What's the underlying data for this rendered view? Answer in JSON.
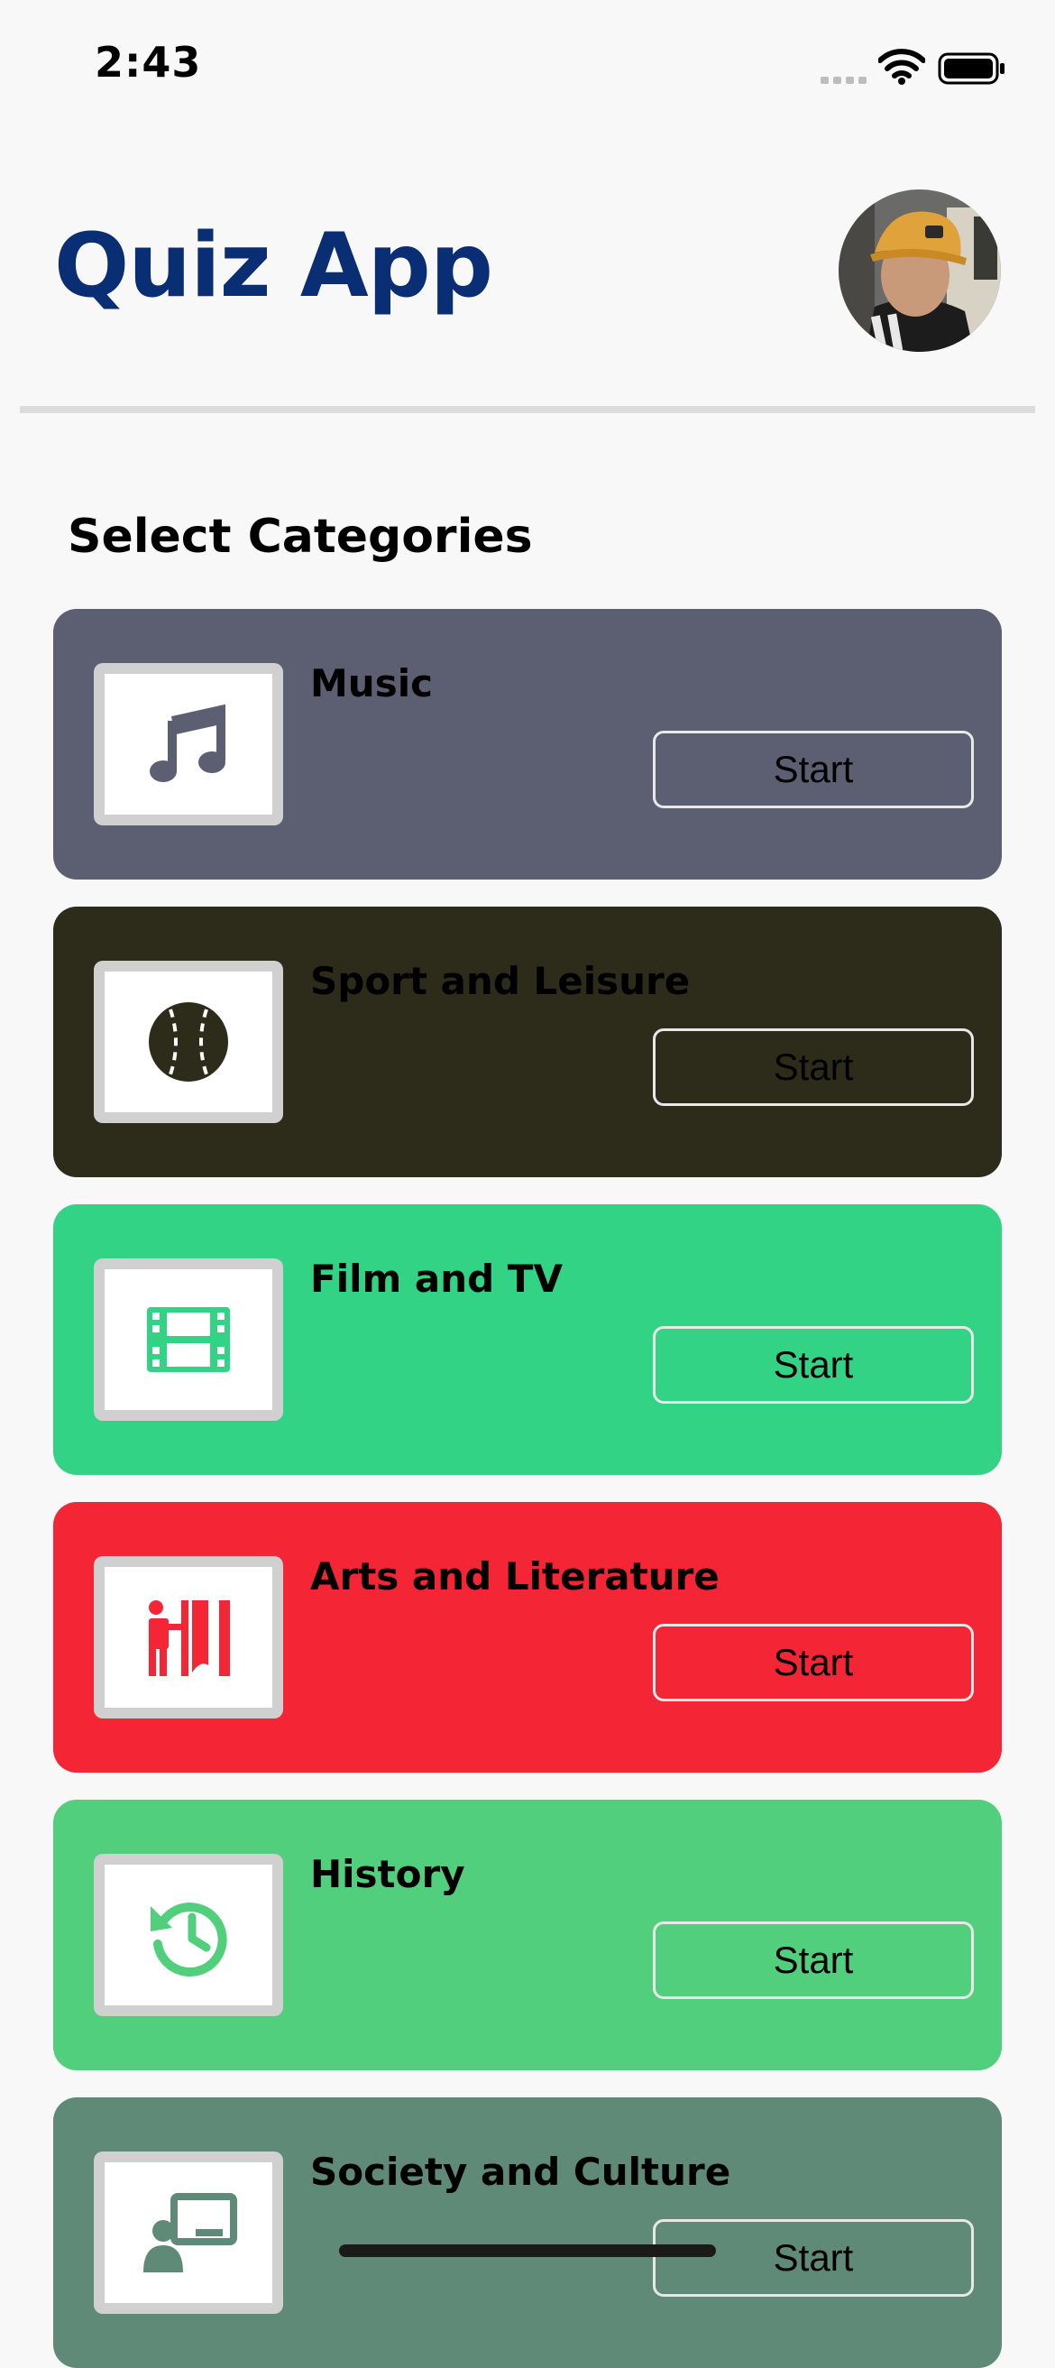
{
  "status_bar": {
    "time": "2:43"
  },
  "header": {
    "title": "Quiz App"
  },
  "section_title": "Select Categories",
  "categories": [
    {
      "title": "Music",
      "icon": "music-note-icon",
      "color": "#5c5f72",
      "start_label": "Start"
    },
    {
      "title": "Sport and Leisure",
      "icon": "baseball-icon",
      "color": "#2d2c1b",
      "start_label": "Start"
    },
    {
      "title": "Film and TV",
      "icon": "film-icon",
      "color": "#33d386",
      "start_label": "Start"
    },
    {
      "title": "Arts and Literature",
      "icon": "theater-icon",
      "color": "#f42535",
      "start_label": "Start"
    },
    {
      "title": "History",
      "icon": "history-icon",
      "color": "#51cf7c",
      "start_label": "Start"
    },
    {
      "title": "Society and Culture",
      "icon": "presentation-icon",
      "color": "#608a78",
      "start_label": "Start"
    }
  ]
}
